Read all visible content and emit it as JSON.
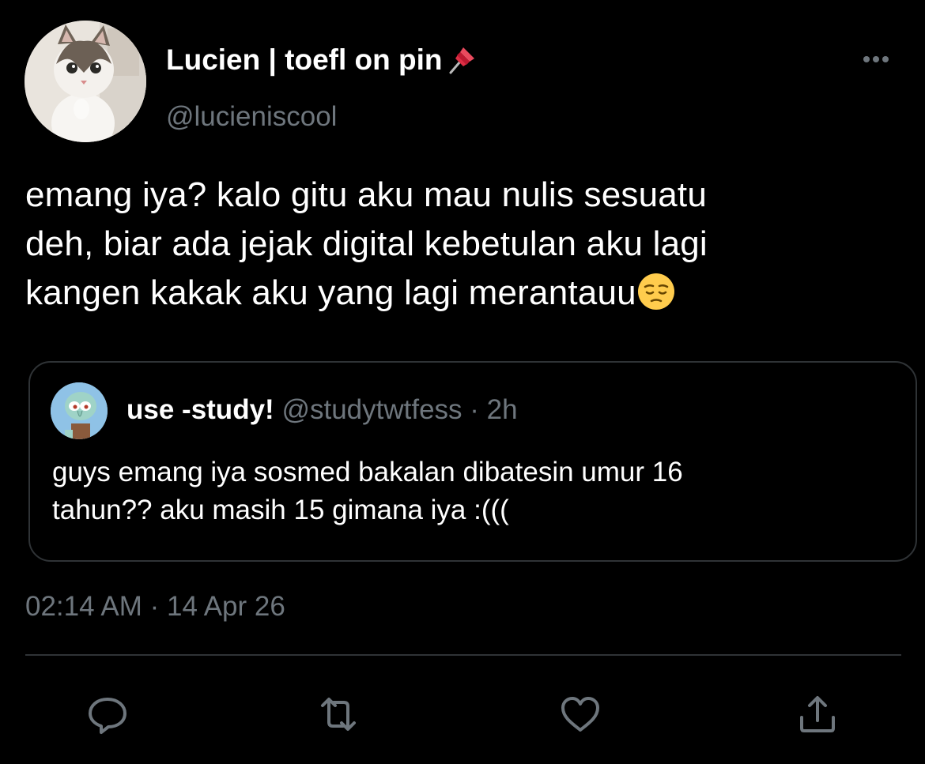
{
  "author": {
    "display_name": "Lucien | toefl on pin",
    "name_emoji": "pushpin-icon",
    "handle": "@lucieniscool"
  },
  "tweet": {
    "lines": [
      "emang iya? kalo gitu aku mau nulis sesuatu",
      "deh, biar ada jejak digital kebetulan aku lagi",
      "kangen kakak aku yang lagi merantauu"
    ],
    "trailing_emoji": "pensive-face-icon"
  },
  "quoted_tweet": {
    "name": "use -study!",
    "handle": "@studytwtfess",
    "separator": "·",
    "time": "2h",
    "lines": [
      "guys emang iya sosmed bakalan dibatesin umur 16",
      "tahun?? aku masih 15 gimana iya :((("
    ]
  },
  "meta": {
    "timestamp": "02:14 AM · 14 Apr 26"
  },
  "actions": [
    "reply-icon",
    "retweet-icon",
    "like-icon",
    "share-icon"
  ],
  "colors": {
    "background": "#000000",
    "primary_text": "#ffffff",
    "secondary_text": "#6e767d",
    "border": "#2f3336"
  }
}
